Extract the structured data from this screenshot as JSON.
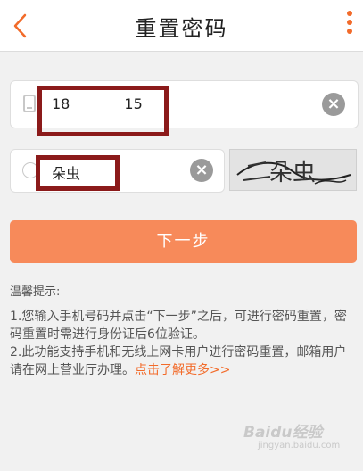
{
  "header": {
    "title": "重置密码"
  },
  "phone": {
    "value": "18            15"
  },
  "captcha": {
    "value": "朵虫",
    "image_text": "朵虫"
  },
  "actions": {
    "next_label": "下一步"
  },
  "tips": {
    "title": "温馨提示:",
    "line1": "1.您输入手机号码并点击“下一步”之后，可进行密码重置，密码重置时需进行身份证后6位验证。",
    "line2": "2.此功能支持手机和无线上网卡用户进行密码重置，邮箱用户请在网上营业厅办理。",
    "link": "点击了解更多>>"
  },
  "watermark": {
    "logo": "Baidu经验",
    "sub": "jingyan.baidu.com"
  },
  "colors": {
    "accent": "#f26b2a",
    "button": "#f78a5a",
    "redact_box": "#8b1a1a"
  }
}
